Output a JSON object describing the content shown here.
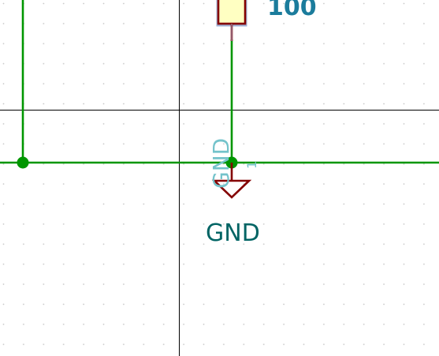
{
  "schematic": {
    "resistor": {
      "value": "100",
      "pin_number": "1"
    },
    "ground_symbol": {
      "pin_name": "GND",
      "pin_number": "1",
      "net_label": "GND"
    }
  },
  "colors": {
    "background": "#ffffff",
    "grid_dot": "#c8c8c8",
    "wire": "#009600",
    "junction": "#009600",
    "symbol_body": "#840000",
    "symbol_fill": "#ffffc2",
    "selection_outline": "#9fb2d6",
    "value_text": "#1b7c9c",
    "net_label_text": "#006464",
    "pin_name_text": "#74c3cb",
    "crosshair": "#000000"
  }
}
